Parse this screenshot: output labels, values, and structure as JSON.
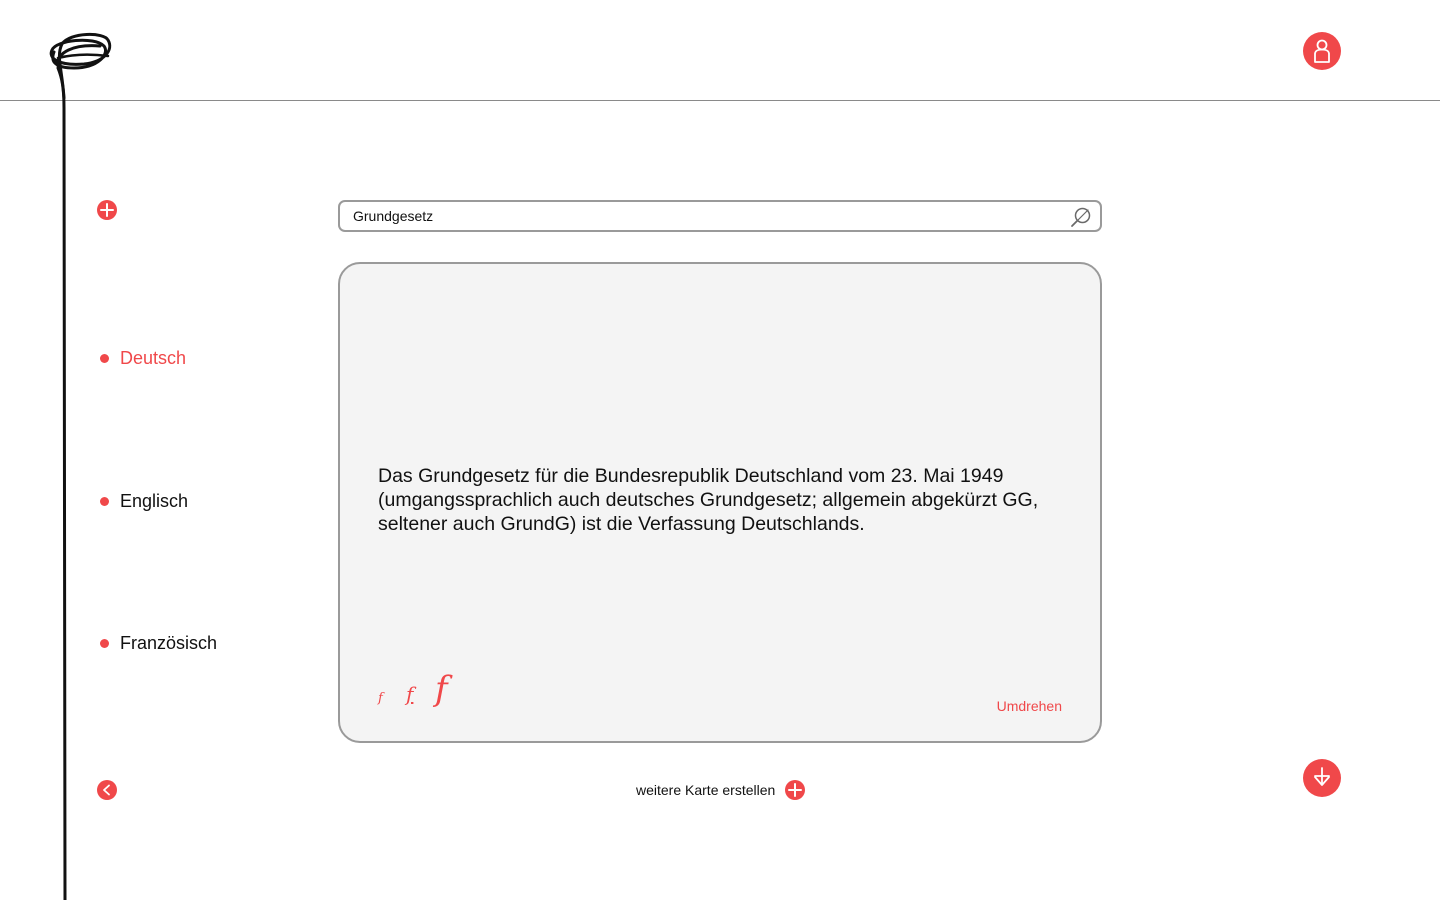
{
  "search": {
    "value": "Grundgesetz",
    "placeholder": ""
  },
  "sidebar": {
    "languages": [
      {
        "label": "Deutsch",
        "active": true
      },
      {
        "label": "Englisch",
        "active": false
      },
      {
        "label": "Französisch",
        "active": false
      }
    ]
  },
  "card": {
    "text": "Das Grundgesetz für die Bundesrepublik Deutschland vom 23. Mai 1949 (umgangssprachlich auch deutsches Grundgesetz; allgemein abgekürzt GG, seltener auch GrundG) ist die Verfassung Deutschlands.",
    "font_size_small": "f",
    "font_size_medium": "f",
    "font_size_large": "f",
    "flip_label": "Umdrehen"
  },
  "footer": {
    "new_card_label": "weitere Karte erstellen"
  },
  "icons": {
    "logo": "scribble-logo-icon",
    "user": "user-icon",
    "add": "plus-icon",
    "back": "chevron-left-icon",
    "download": "download-icon",
    "search": "search-icon"
  },
  "colors": {
    "accent": "#f0484a",
    "card_background": "#f4f4f4",
    "border": "#9a9a9a"
  }
}
